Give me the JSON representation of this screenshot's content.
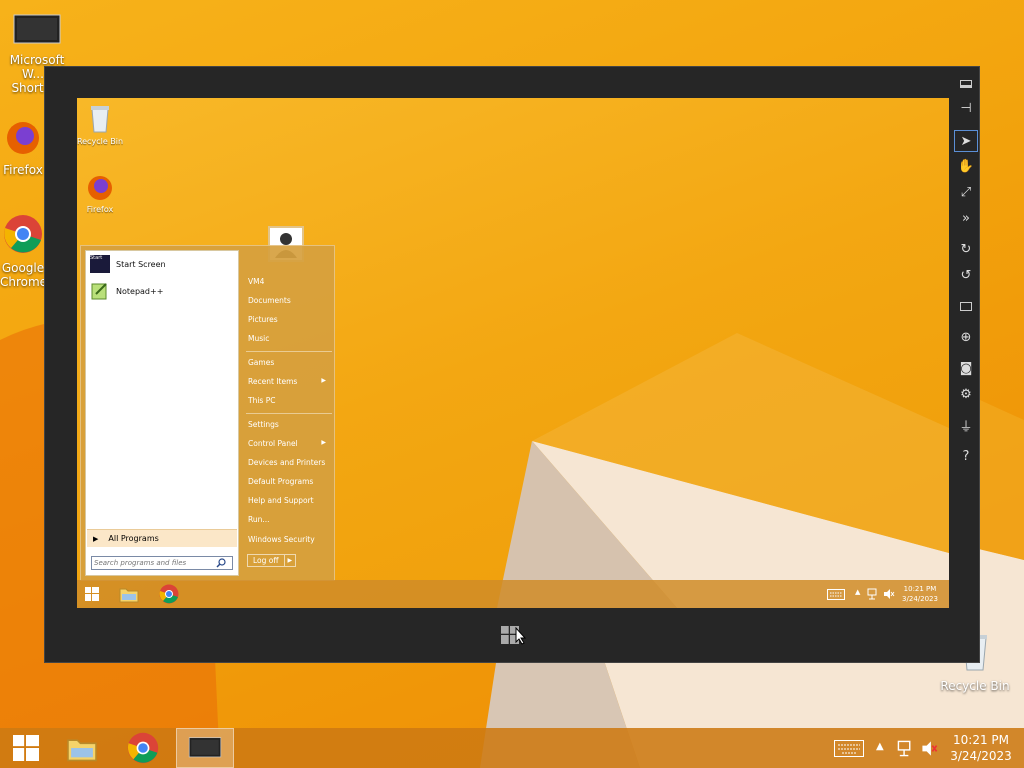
{
  "host": {
    "desktop_icons": [
      {
        "label": "Microsoft W... - Shortcut",
        "icon": "monitor-icon"
      },
      {
        "label": "Firefox",
        "icon": "firefox-icon"
      },
      {
        "label": "Google Chrome",
        "icon": "chrome-icon"
      },
      {
        "label": "Recycle Bin",
        "icon": "recycle-bin-icon"
      }
    ],
    "taskbar": {
      "buttons": [
        {
          "name": "start",
          "icon": "windows-logo-icon"
        },
        {
          "name": "file-explorer",
          "icon": "folder-icon"
        },
        {
          "name": "chrome",
          "icon": "chrome-icon"
        },
        {
          "name": "remote-desktop",
          "icon": "monitor-icon",
          "active": true
        }
      ],
      "time": "10:21 PM",
      "date": "3/24/2023"
    }
  },
  "vm_toolbar": {
    "tools": [
      "minimize-icon",
      "pin-icon",
      "pointer-icon",
      "hand-icon",
      "expand-icon",
      "fast-forward-icon",
      "rotate-right-icon",
      "rotate-left-icon",
      "monitor-icon",
      "globe-icon",
      "camera-icon",
      "gear-icon",
      "plug-icon",
      "help-icon"
    ],
    "selected": "pointer-icon",
    "help_label": "?"
  },
  "guest": {
    "desktop_icons": [
      {
        "label": "Recycle Bin",
        "icon": "recycle-bin-icon"
      },
      {
        "label": "Firefox",
        "icon": "firefox-icon"
      }
    ],
    "start_menu": {
      "pinned": [
        {
          "label": "Start Screen",
          "icon": "start-screen-icon"
        },
        {
          "label": "Notepad++",
          "icon": "notepadpp-icon"
        }
      ],
      "start_tile_text": "Start",
      "all_programs": "All Programs",
      "search_placeholder": "Search programs and files",
      "right_items": [
        {
          "label": "VM4",
          "has_arrow": false
        },
        {
          "label": "Documents",
          "has_arrow": false
        },
        {
          "label": "Pictures",
          "has_arrow": false
        },
        {
          "label": "Music",
          "has_arrow": false
        },
        {
          "label": "Games",
          "has_arrow": false
        },
        {
          "label": "Recent Items",
          "has_arrow": true
        },
        {
          "label": "This PC",
          "has_arrow": false
        },
        {
          "label": "Settings",
          "has_arrow": false
        },
        {
          "label": "Control Panel",
          "has_arrow": true
        },
        {
          "label": "Devices and Printers",
          "has_arrow": false
        },
        {
          "label": "Default Programs",
          "has_arrow": false
        },
        {
          "label": "Help and Support",
          "has_arrow": false
        },
        {
          "label": "Run...",
          "has_arrow": false
        },
        {
          "label": "Windows Security",
          "has_arrow": false
        }
      ],
      "log_off": "Log off"
    },
    "taskbar": {
      "time": "10:21 PM",
      "date": "3/24/2023"
    }
  },
  "colors": {
    "wallpaper": "#f3a712",
    "vm_frame": "#262626",
    "taskbar": "#cd7a12"
  }
}
